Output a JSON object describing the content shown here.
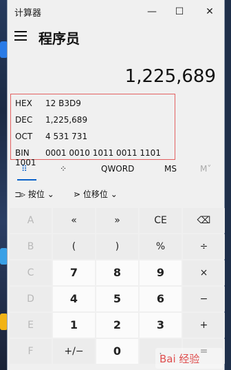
{
  "app": {
    "title": "计算器",
    "mode": "程序员"
  },
  "window_controls": {
    "minimize": "—",
    "maximize": "☐",
    "close": "✕"
  },
  "display": {
    "value": "1,225,689"
  },
  "radix": [
    {
      "label": "HEX",
      "value": "12 B3D9"
    },
    {
      "label": "DEC",
      "value": "1,225,689"
    },
    {
      "label": "OCT",
      "value": "4 531 731"
    },
    {
      "label": "BIN",
      "value": "0001 0010 1011 0011 1101 1001"
    }
  ],
  "tabs": {
    "word_size": "QWORD",
    "ms": "MS",
    "m": "M˅"
  },
  "bitwise": {
    "bitwise_label": "按位",
    "shift_label": "位移位"
  },
  "keys": [
    [
      "A",
      "«",
      "»",
      "CE",
      "⌫"
    ],
    [
      "B",
      "(",
      ")",
      "%",
      "÷"
    ],
    [
      "C",
      "7",
      "8",
      "9",
      "×"
    ],
    [
      "D",
      "4",
      "5",
      "6",
      "−"
    ],
    [
      "E",
      "1",
      "2",
      "3",
      "+"
    ],
    [
      "F",
      "+/−",
      "0",
      ".",
      "="
    ]
  ],
  "watermark": {
    "text": "Bai 经验"
  },
  "accent": "#0a61c9"
}
